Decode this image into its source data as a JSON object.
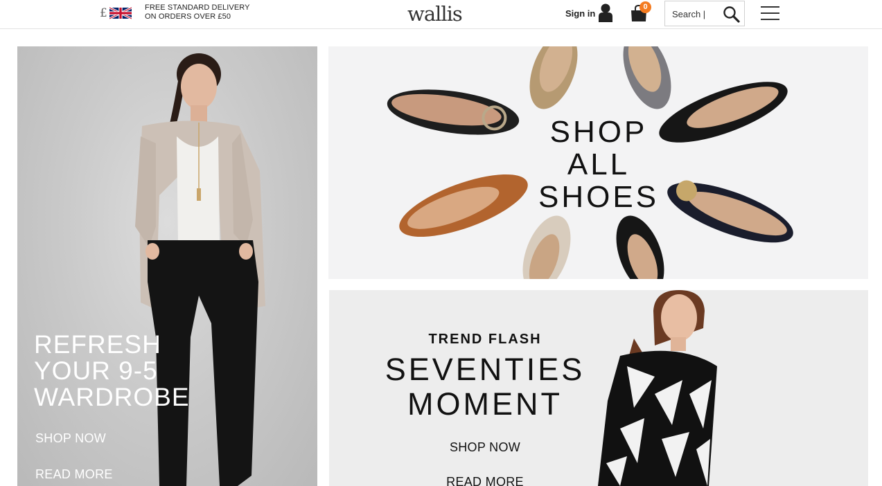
{
  "header": {
    "currency_symbol": "£",
    "flag_icon": "uk-flag-icon",
    "delivery_line1": "FREE STANDARD DELIVERY",
    "delivery_line2": "ON ORDERS OVER £50",
    "logo": "wallis",
    "signin_label": "Sign in",
    "user_icon": "user-icon",
    "bag_icon": "shopping-bag-icon",
    "bag_count": "0",
    "search_placeholder": "Search |",
    "search_icon": "search-icon",
    "menu_icon": "hamburger-menu-icon",
    "accent_color": "#f47b20"
  },
  "promo_left": {
    "headline_line1": "REFRESH",
    "headline_line2": "YOUR 9-5",
    "headline_line3": "WARDROBE",
    "shop_now": "SHOP NOW",
    "read_more": "READ MORE"
  },
  "promo_shoes": {
    "line1": "SHOP",
    "line2": "ALL",
    "line3": "SHOES"
  },
  "promo_trend": {
    "kicker": "TREND FLASH",
    "title_line1": "SEVENTIES",
    "title_line2": "MOMENT",
    "shop_now": "SHOP NOW",
    "read_more": "READ MORE"
  }
}
